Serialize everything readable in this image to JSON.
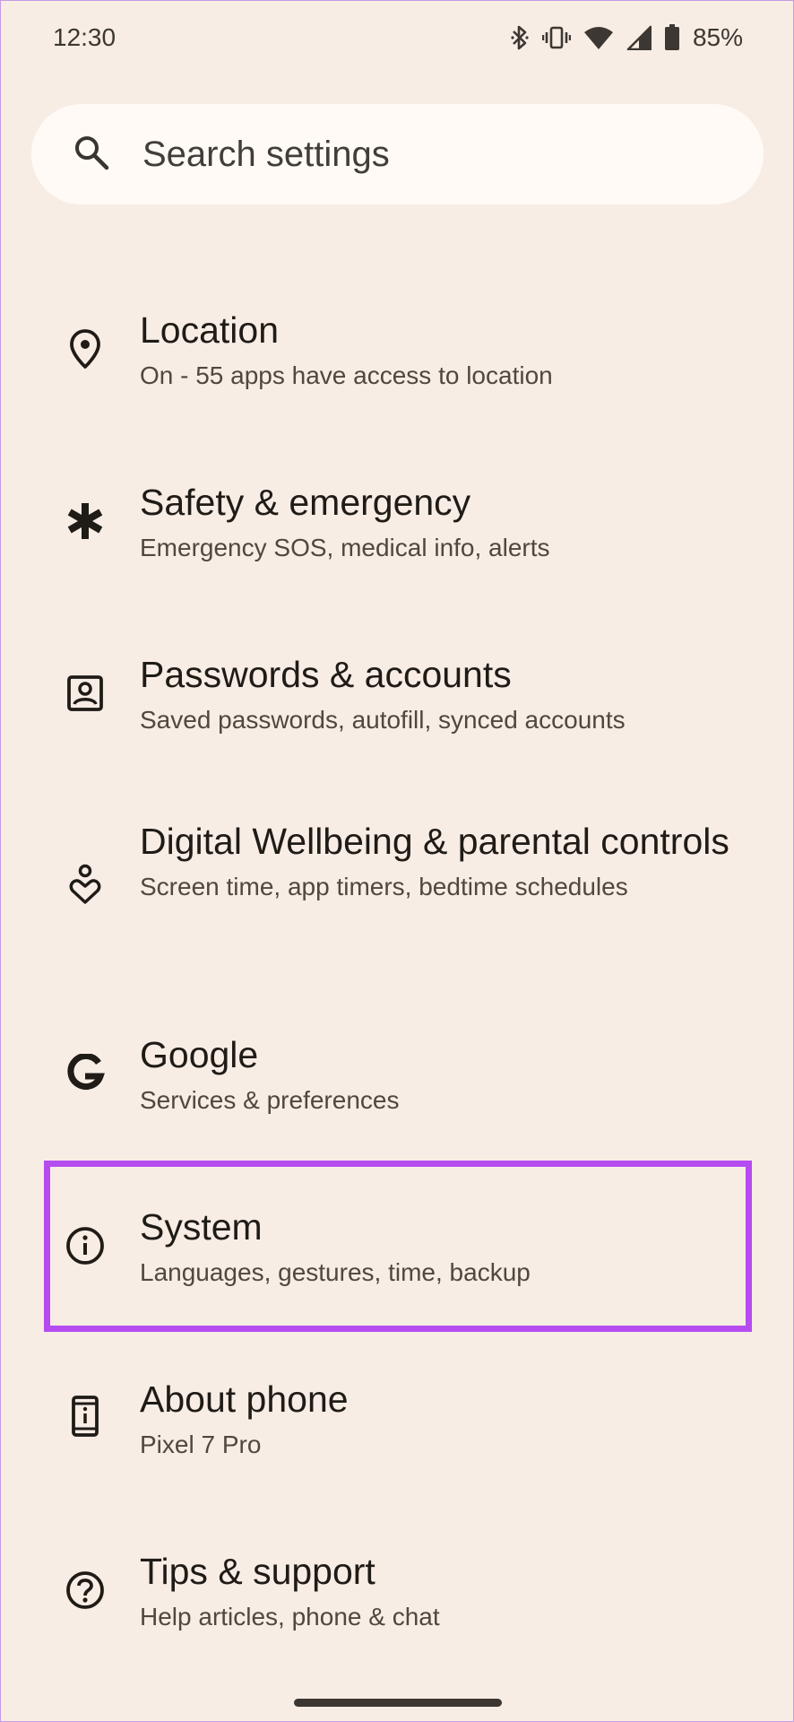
{
  "status_bar": {
    "time": "12:30",
    "battery": "85%",
    "icons": [
      "bluetooth-icon",
      "vibrate-icon",
      "wifi-icon",
      "signal-icon",
      "battery-icon"
    ]
  },
  "search": {
    "placeholder": "Search settings",
    "icon": "search-icon"
  },
  "settings": [
    {
      "title": "Location",
      "subtitle": "On - 55 apps have access to location",
      "icon": "location-pin-icon"
    },
    {
      "title": "Safety & emergency",
      "subtitle": "Emergency SOS, medical info, alerts",
      "icon": "asterisk-icon"
    },
    {
      "title": "Passwords & accounts",
      "subtitle": "Saved passwords, autofill, synced accounts",
      "icon": "account-box-icon"
    },
    {
      "title": "Digital Wellbeing & parental controls",
      "subtitle": "Screen time, app timers, bedtime schedules",
      "icon": "wellbeing-icon"
    },
    {
      "title": "Google",
      "subtitle": "Services & preferences",
      "icon": "google-icon"
    },
    {
      "title": "System",
      "subtitle": "Languages, gestures, time, backup",
      "icon": "info-icon"
    },
    {
      "title": "About phone",
      "subtitle": "Pixel 7 Pro",
      "icon": "phone-info-icon"
    },
    {
      "title": "Tips & support",
      "subtitle": "Help articles, phone & chat",
      "icon": "help-icon"
    }
  ],
  "colors": {
    "background": "#f8ede5",
    "search_background": "#fffaf6",
    "highlight_border": "#b54cf0",
    "text_primary": "#1f1b17",
    "text_secondary": "#4f4740"
  }
}
